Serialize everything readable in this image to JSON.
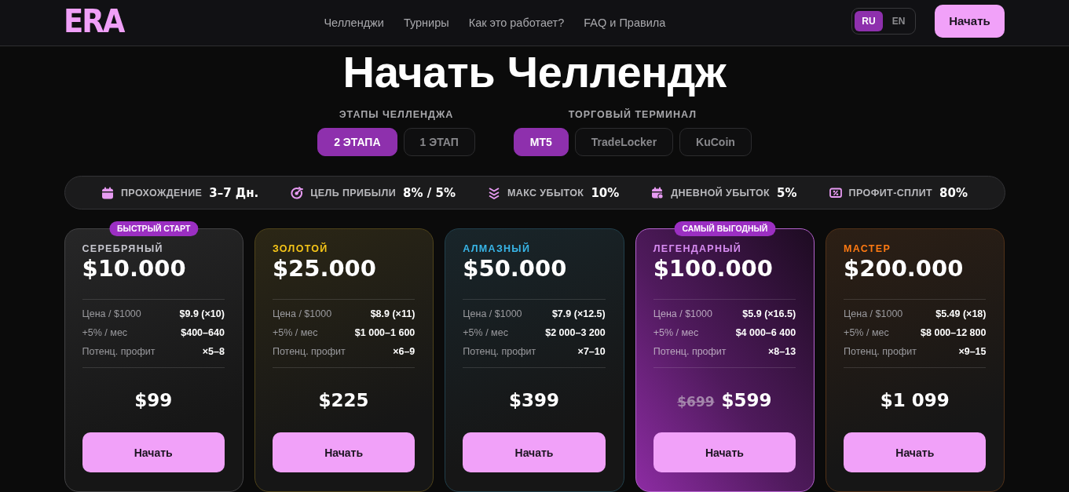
{
  "header": {
    "logo": "ERA",
    "nav": [
      "Челленджи",
      "Турниры",
      "Как это работает?",
      "FAQ и Правила"
    ],
    "languages": [
      {
        "label": "RU",
        "selected": true
      },
      {
        "label": "EN",
        "selected": false
      }
    ],
    "cta": "Начать"
  },
  "title": "Начать Челлендж",
  "selectors": [
    {
      "label": "ЭТАПЫ ЧЕЛЛЕНДЖА",
      "options": [
        {
          "label": "2 ЭТАПА",
          "selected": true
        },
        {
          "label": "1 ЭТАП",
          "selected": false
        }
      ]
    },
    {
      "label": "ТОРГОВЫЙ ТЕРМИНАЛ",
      "options": [
        {
          "label": "MT5",
          "selected": true
        },
        {
          "label": "TradeLocker",
          "selected": false
        },
        {
          "label": "KuCoin",
          "selected": false
        }
      ]
    }
  ],
  "rules": [
    {
      "label": "ПРОХОЖДЕНИЕ",
      "value": "3–7 Дн."
    },
    {
      "label": "ЦЕЛЬ ПРИБЫЛИ",
      "value": "8% / 5%"
    },
    {
      "label": "МАКС УБЫТОК",
      "value": "10%"
    },
    {
      "label": "ДНЕВНОЙ УБЫТОК",
      "value": "5%"
    },
    {
      "label": "ПРОФИТ-СПЛИТ",
      "value": "80%"
    }
  ],
  "plans": [
    {
      "badge": "БЫСТРЫЙ СТАРТ",
      "tier": "СЕРЕБРЯНЫЙ",
      "color": "#c6c6ce",
      "featured": false,
      "amount": "$10.000",
      "rows": [
        {
          "label": "Цена / $1000",
          "value": "$9.9 (×10)"
        },
        {
          "label": "+5% / мес",
          "value": "$400–640"
        },
        {
          "label": "Потенц. профит",
          "value": "×5–8"
        }
      ],
      "price": "$99",
      "button": "Начать"
    },
    {
      "tier": "ЗОЛОТОЙ",
      "color": "#f5c518",
      "featured": false,
      "amount": "$25.000",
      "rows": [
        {
          "label": "Цена / $1000",
          "value": "$8.9 (×11)"
        },
        {
          "label": "+5% / мес",
          "value": "$1 000–1 600"
        },
        {
          "label": "Потенц. профит",
          "value": "×6–9"
        }
      ],
      "price": "$225",
      "button": "Начать"
    },
    {
      "tier": "АЛМАЗНЫЙ",
      "color": "#38b6e8",
      "featured": false,
      "amount": "$50.000",
      "rows": [
        {
          "label": "Цена / $1000",
          "value": "$7.9 (×12.5)"
        },
        {
          "label": "+5% / мес",
          "value": "$2 000–3 200"
        },
        {
          "label": "Потенц. профит",
          "value": "×7–10"
        }
      ],
      "price": "$399",
      "button": "Начать"
    },
    {
      "badge": "САМЫЙ ВЫГОДНЫЙ",
      "tier": "ЛЕГЕНДАРНЫЙ",
      "color": "#d88cf2",
      "featured": true,
      "amount": "$100.000",
      "rows": [
        {
          "label": "Цена / $1000",
          "value": "$5.9 (×16.5)"
        },
        {
          "label": "+5% / мес",
          "value": "$4 000–6 400"
        },
        {
          "label": "Потенц. профит",
          "value": "×8–13"
        }
      ],
      "old_price": "$699",
      "price": "$599",
      "button": "Начать"
    },
    {
      "tier": "МАСТЕР",
      "color": "#ff7a12",
      "featured": false,
      "amount": "$200.000",
      "rows": [
        {
          "label": "Цена / $1000",
          "value": "$5.49 (×18)"
        },
        {
          "label": "+5% / мес",
          "value": "$8 000–12 800"
        },
        {
          "label": "Потенц. профит",
          "value": "×9–15"
        }
      ],
      "price": "$1 099",
      "button": "Начать"
    }
  ]
}
